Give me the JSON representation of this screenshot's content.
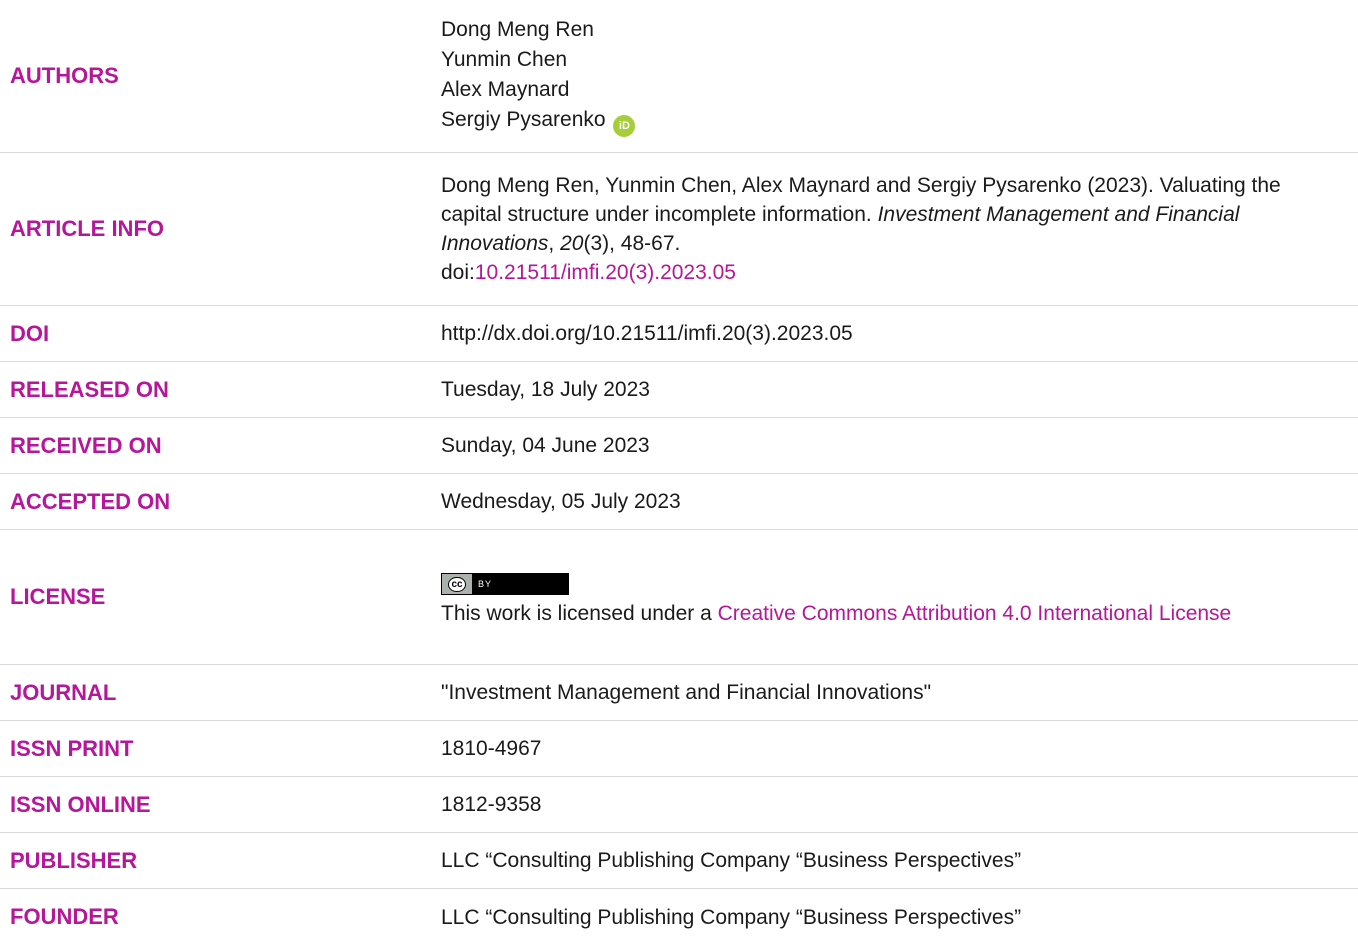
{
  "rows": {
    "authors": {
      "label": "AUTHORS",
      "names": [
        "Dong Meng Ren",
        "Yunmin Chen",
        "Alex Maynard",
        "Sergiy Pysarenko"
      ],
      "orcid_icon": "orcid-icon"
    },
    "article_info": {
      "label": "ARTICLE INFO",
      "citation_prefix": "Dong Meng Ren, Yunmin Chen, Alex Maynard and Sergiy Pysarenko (2023). Valuating the capital structure under incomplete information. ",
      "journal_italic": "Investment Management and Financial Innovations",
      "comma": ", ",
      "volume_italic": "20",
      "issue_pages": "(3), 48-67.",
      "doi_prefix": "doi:",
      "doi_link": "10.21511/imfi.20(3).2023.05"
    },
    "doi": {
      "label": "DOI",
      "value": "http://dx.doi.org/10.21511/imfi.20(3).2023.05"
    },
    "released_on": {
      "label": "RELEASED ON",
      "value": "Tuesday, 18 July 2023"
    },
    "received_on": {
      "label": "RECEIVED ON",
      "value": "Sunday, 04 June 2023"
    },
    "accepted_on": {
      "label": "ACCEPTED ON",
      "value": "Wednesday, 05 July 2023"
    },
    "license": {
      "label": "LICENSE",
      "badge_cc": "cc",
      "badge_by": "BY",
      "text_prefix": "This work is licensed under a ",
      "link": "Creative Commons Attribution 4.0 International License"
    },
    "journal": {
      "label": "JOURNAL",
      "value": "\"Investment Management and Financial Innovations\""
    },
    "issn_print": {
      "label": "ISSN PRINT",
      "value": "1810-4967"
    },
    "issn_online": {
      "label": "ISSN ONLINE",
      "value": "1812-9358"
    },
    "publisher": {
      "label": "PUBLISHER",
      "value": "LLC “Consulting Publishing Company “Business Perspectives”"
    },
    "founder": {
      "label": "FOUNDER",
      "value": "LLC “Consulting Publishing Company “Business Perspectives”"
    }
  },
  "colors": {
    "accent": "#b5169a",
    "text": "#1a1a1a",
    "divider": "#d9d9d9",
    "orcid": "#a6ce39"
  }
}
